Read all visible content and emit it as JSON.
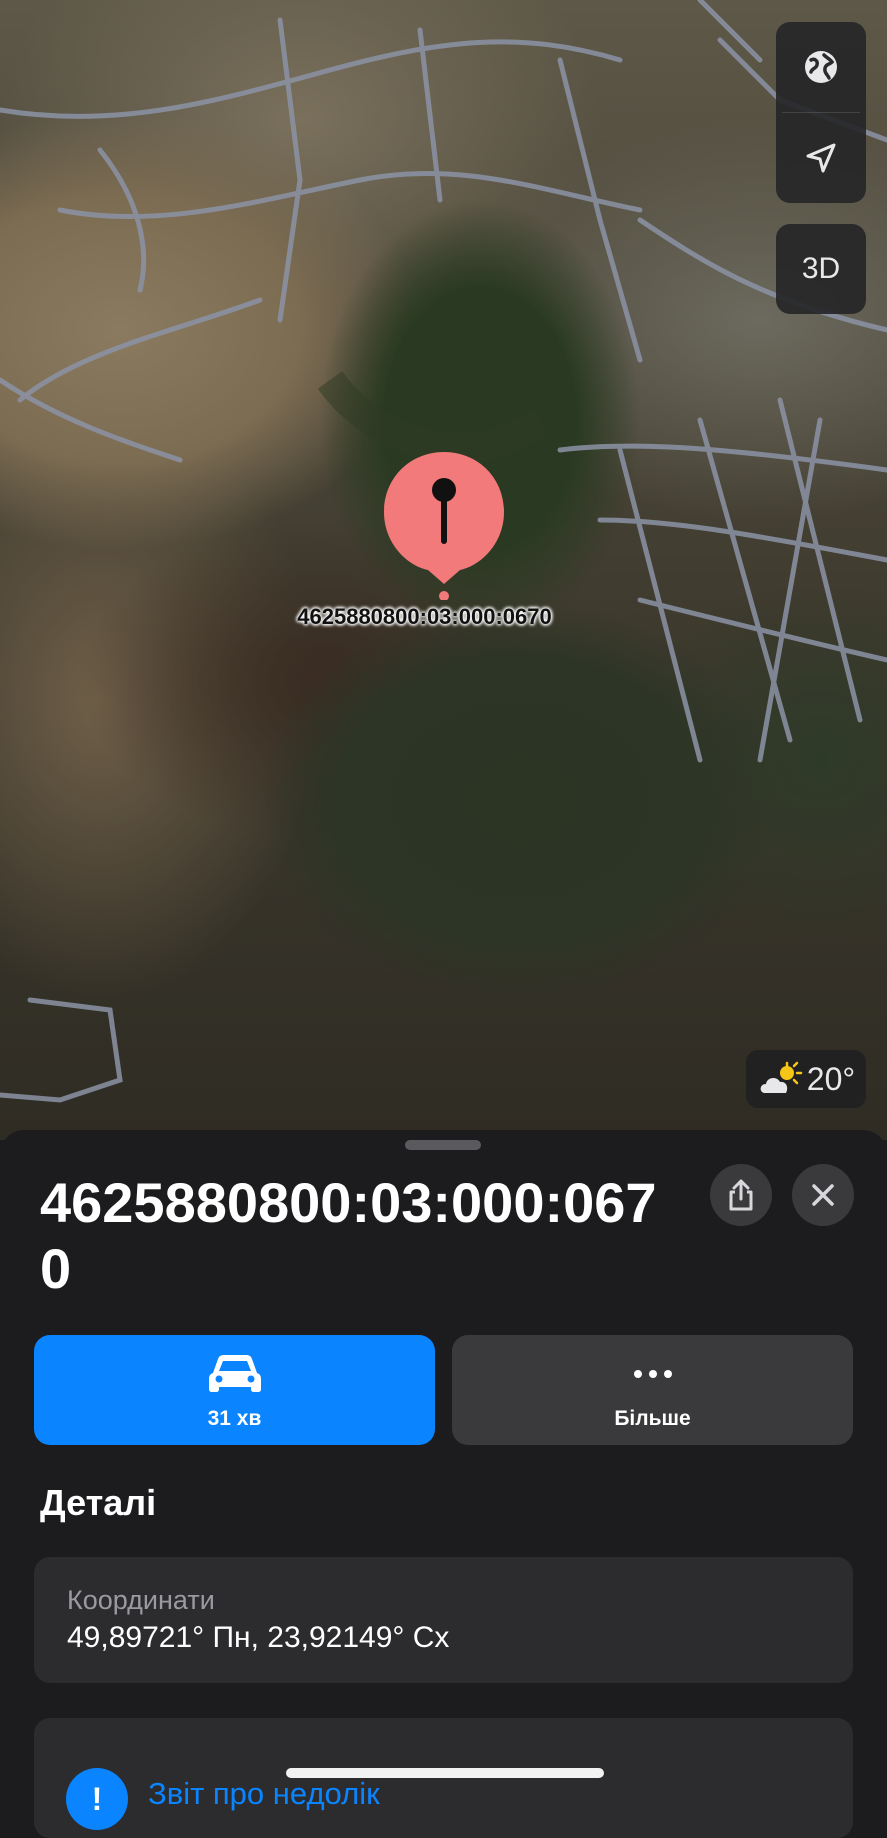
{
  "map": {
    "pin_label": "4625880800:03:000:0670",
    "controls": {
      "globe_icon": "globe-icon",
      "location_icon": "location-arrow-icon",
      "three_d_label": "3D"
    },
    "weather": {
      "icon": "partly-sunny-icon",
      "temperature": "20°"
    },
    "pin_color": "#f27a7a"
  },
  "sheet": {
    "title": "4625880800:03:000:0670",
    "share_icon": "share-icon",
    "close_icon": "close-icon",
    "actions": {
      "directions": {
        "icon": "car-icon",
        "label": "31 хв",
        "color": "#0a84ff"
      },
      "more": {
        "icon": "ellipsis-icon",
        "label": "Більше"
      }
    },
    "details": {
      "heading": "Деталі",
      "coordinates_label": "Координати",
      "coordinates_value": "49,89721° Пн, 23,92149° Сх"
    },
    "report": {
      "icon": "report-issue-icon",
      "label": "Звіт про недолік"
    }
  }
}
